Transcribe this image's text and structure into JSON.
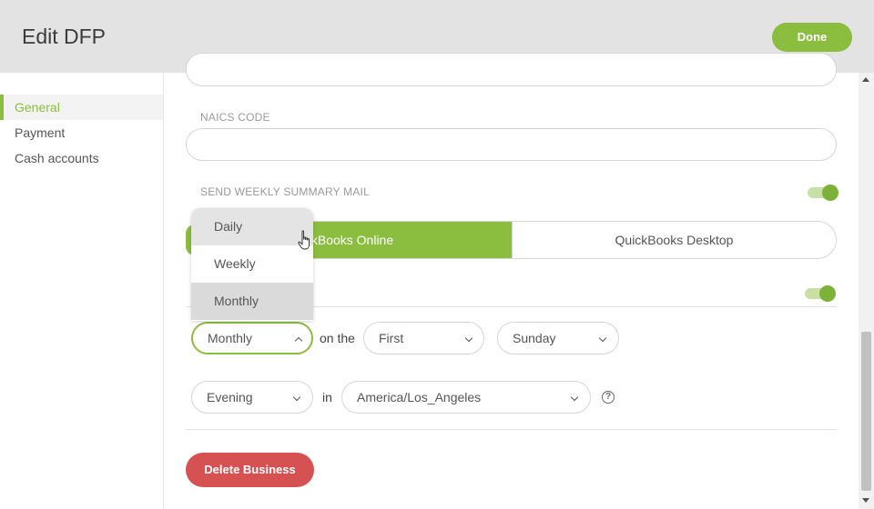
{
  "header": {
    "title": "Edit DFP",
    "done_label": "Done"
  },
  "sidebar": {
    "items": [
      {
        "label": "General",
        "active": true
      },
      {
        "label": "Payment",
        "active": false
      },
      {
        "label": "Cash accounts",
        "active": false
      }
    ]
  },
  "form": {
    "naics_label": "NAICS CODE",
    "naics_value": "",
    "weekly_mail_label": "SEND WEEKLY SUMMARY MAIL",
    "weekly_mail_enabled": true,
    "second_toggle_enabled": true,
    "integration": {
      "options": [
        "QuickBooks Online",
        "QuickBooks Desktop"
      ],
      "selected_visible": "ckBooks Online",
      "other": "QuickBooks Desktop"
    },
    "schedule": {
      "frequency": "Monthly",
      "frequency_options": [
        "Daily",
        "Weekly",
        "Monthly"
      ],
      "on_the_text": "on the",
      "ordinal": "First",
      "weekday": "Sunday",
      "time_of_day": "Evening",
      "in_text": "in",
      "timezone": "America/Los_Angeles"
    },
    "delete_label": "Delete Business"
  },
  "colors": {
    "accent": "#8bbd3f",
    "danger": "#d65252",
    "header_bg": "#e3e3e3"
  }
}
